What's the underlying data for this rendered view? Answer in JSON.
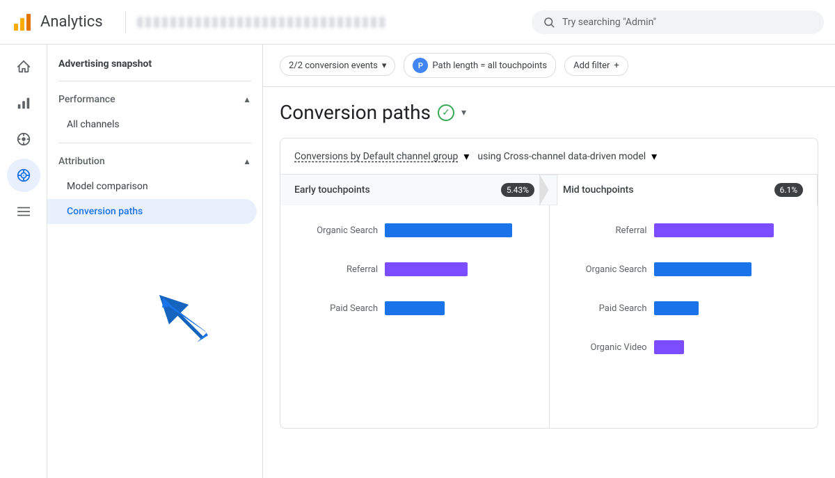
{
  "header": {
    "title": "Analytics",
    "search_placeholder": "Try searching \"Admin\""
  },
  "sidebar": {
    "snapshot_label": "Advertising snapshot",
    "performance": {
      "title": "Performance",
      "items": [
        "All channels"
      ]
    },
    "attribution": {
      "title": "Attribution",
      "items": [
        "Model comparison",
        "Conversion paths"
      ]
    }
  },
  "filter_bar": {
    "conversion_events": "2/2 conversion events",
    "path_length": "Path length = all touchpoints",
    "add_filter": "Add filter"
  },
  "page": {
    "title": "Conversion paths",
    "chart_label": "Conversions by Default channel group",
    "chart_model": "using Cross-channel data-driven model"
  },
  "touchpoints": [
    {
      "label": "Early touchpoints",
      "badge": "5.43%"
    },
    {
      "label": "Mid touchpoints",
      "badge": "6.1%"
    }
  ],
  "bars_left": [
    {
      "label": "Organic Search",
      "value": 85,
      "color": "blue"
    },
    {
      "label": "Referral",
      "value": 55,
      "color": "purple"
    },
    {
      "label": "Paid Search",
      "value": 40,
      "color": "blue"
    }
  ],
  "bars_right": [
    {
      "label": "Referral",
      "value": 80,
      "color": "purple"
    },
    {
      "label": "Organic Search",
      "value": 65,
      "color": "blue"
    },
    {
      "label": "Paid Search",
      "value": 30,
      "color": "blue"
    },
    {
      "label": "Organic Video",
      "value": 20,
      "color": "purple"
    }
  ],
  "rail_icons": [
    {
      "name": "home-icon",
      "symbol": "⌂",
      "active": false
    },
    {
      "name": "bar-chart-icon",
      "symbol": "▦",
      "active": false
    },
    {
      "name": "analytics-icon",
      "symbol": "◎",
      "active": false
    },
    {
      "name": "wifi-icon",
      "symbol": "◉",
      "active": true
    },
    {
      "name": "list-icon",
      "symbol": "≡",
      "active": false
    }
  ]
}
